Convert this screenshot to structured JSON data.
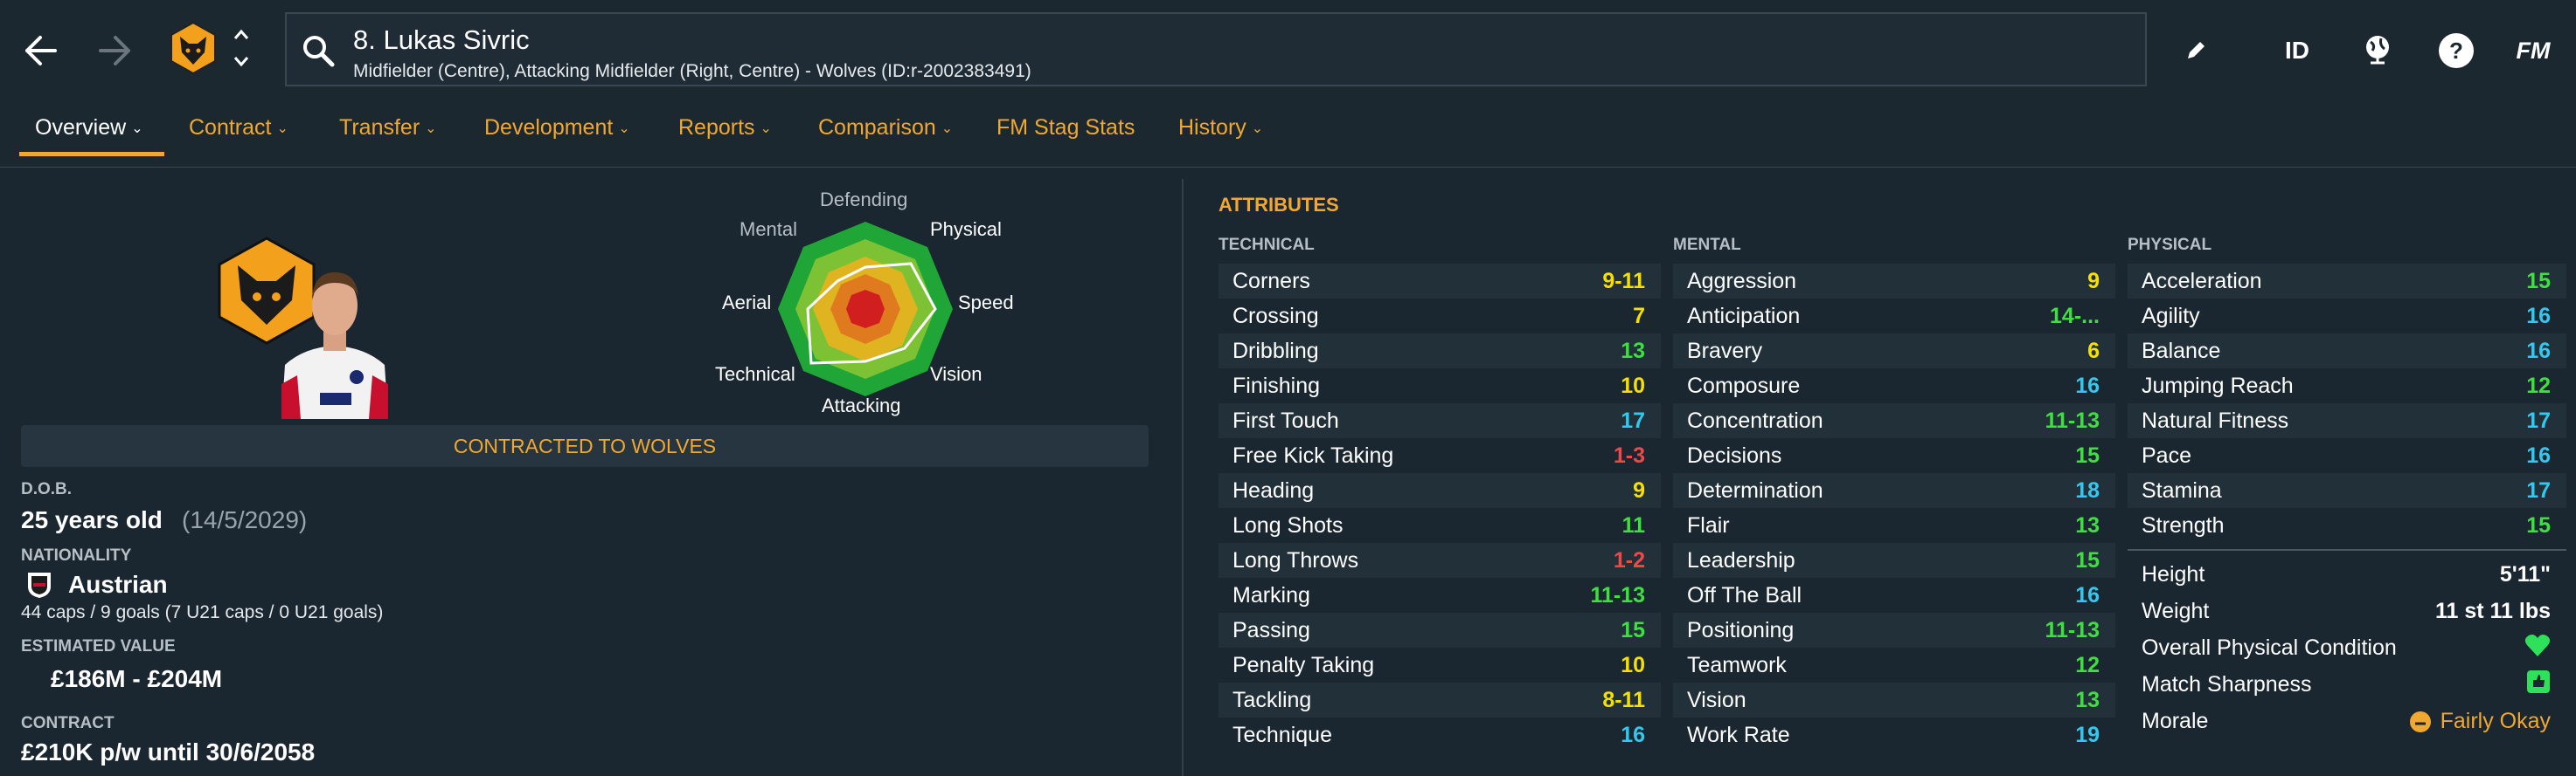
{
  "header": {
    "player_name": "8. Lukas Sivric",
    "player_desc": "Midfielder (Centre), Attacking Midfielder (Right, Centre) - Wolves (ID:r-2002383491)",
    "id_label": "ID",
    "fm_label": "FM"
  },
  "tabs": [
    "Overview",
    "Contract",
    "Transfer",
    "Development",
    "Reports",
    "Comparison",
    "FM Stag Stats",
    "History"
  ],
  "radar": {
    "labels": [
      "Defending",
      "Physical",
      "Speed",
      "Vision",
      "Attacking",
      "Technical",
      "Aerial",
      "Mental"
    ]
  },
  "status": "CONTRACTED TO WOLVES",
  "info": {
    "dob_label": "D.O.B.",
    "age": "25 years old",
    "dob": "(14/5/2029)",
    "nat_label": "NATIONALITY",
    "nationality": "Austrian",
    "caps": "44 caps / 9 goals (7 U21 caps / 0 U21 goals)",
    "value_label": "ESTIMATED VALUE",
    "value": "£186M - £204M",
    "contract_label": "CONTRACT",
    "contract": "£210K p/w until 30/6/2058"
  },
  "attributes": {
    "title": "ATTRIBUTES",
    "technical_label": "TECHNICAL",
    "mental_label": "MENTAL",
    "physical_label": "PHYSICAL",
    "technical": [
      {
        "name": "Corners",
        "value": "9-11",
        "color": "#f5e000"
      },
      {
        "name": "Crossing",
        "value": "7",
        "color": "#f5e000"
      },
      {
        "name": "Dribbling",
        "value": "13",
        "color": "#3ee040"
      },
      {
        "name": "Finishing",
        "value": "10",
        "color": "#f5e000"
      },
      {
        "name": "First Touch",
        "value": "17",
        "color": "#35c8ef"
      },
      {
        "name": "Free Kick Taking",
        "value": "1-3",
        "color": "#f04848"
      },
      {
        "name": "Heading",
        "value": "9",
        "color": "#f5e000"
      },
      {
        "name": "Long Shots",
        "value": "11",
        "color": "#3ee040"
      },
      {
        "name": "Long Throws",
        "value": "1-2",
        "color": "#f04848"
      },
      {
        "name": "Marking",
        "value": "11-13",
        "color": "#3ee040"
      },
      {
        "name": "Passing",
        "value": "15",
        "color": "#3ee040"
      },
      {
        "name": "Penalty Taking",
        "value": "10",
        "color": "#f5e000"
      },
      {
        "name": "Tackling",
        "value": "8-11",
        "color": "#f5e000"
      },
      {
        "name": "Technique",
        "value": "16",
        "color": "#35c8ef"
      }
    ],
    "mental": [
      {
        "name": "Aggression",
        "value": "9",
        "color": "#f5e000"
      },
      {
        "name": "Anticipation",
        "value": "14-...",
        "color": "#3ee040"
      },
      {
        "name": "Bravery",
        "value": "6",
        "color": "#f5e000"
      },
      {
        "name": "Composure",
        "value": "16",
        "color": "#35c8ef"
      },
      {
        "name": "Concentration",
        "value": "11-13",
        "color": "#3ee040"
      },
      {
        "name": "Decisions",
        "value": "15",
        "color": "#3ee040"
      },
      {
        "name": "Determination",
        "value": "18",
        "color": "#35c8ef"
      },
      {
        "name": "Flair",
        "value": "13",
        "color": "#3ee040"
      },
      {
        "name": "Leadership",
        "value": "15",
        "color": "#3ee040"
      },
      {
        "name": "Off The Ball",
        "value": "16",
        "color": "#35c8ef"
      },
      {
        "name": "Positioning",
        "value": "11-13",
        "color": "#3ee040"
      },
      {
        "name": "Teamwork",
        "value": "12",
        "color": "#3ee040"
      },
      {
        "name": "Vision",
        "value": "13",
        "color": "#3ee040"
      },
      {
        "name": "Work Rate",
        "value": "19",
        "color": "#35c8ef"
      }
    ],
    "physical": [
      {
        "name": "Acceleration",
        "value": "15",
        "color": "#3ee040"
      },
      {
        "name": "Agility",
        "value": "16",
        "color": "#35c8ef"
      },
      {
        "name": "Balance",
        "value": "16",
        "color": "#35c8ef"
      },
      {
        "name": "Jumping Reach",
        "value": "12",
        "color": "#3ee040"
      },
      {
        "name": "Natural Fitness",
        "value": "17",
        "color": "#35c8ef"
      },
      {
        "name": "Pace",
        "value": "16",
        "color": "#35c8ef"
      },
      {
        "name": "Stamina",
        "value": "17",
        "color": "#35c8ef"
      },
      {
        "name": "Strength",
        "value": "15",
        "color": "#3ee040"
      }
    ],
    "misc": [
      {
        "name": "Height",
        "value": "5'11\""
      },
      {
        "name": "Weight",
        "value": "11 st 11 lbs"
      },
      {
        "name": "Overall Physical Condition",
        "value": ""
      },
      {
        "name": "Match Sharpness",
        "value": ""
      },
      {
        "name": "Morale",
        "value": "Fairly Okay"
      }
    ]
  }
}
